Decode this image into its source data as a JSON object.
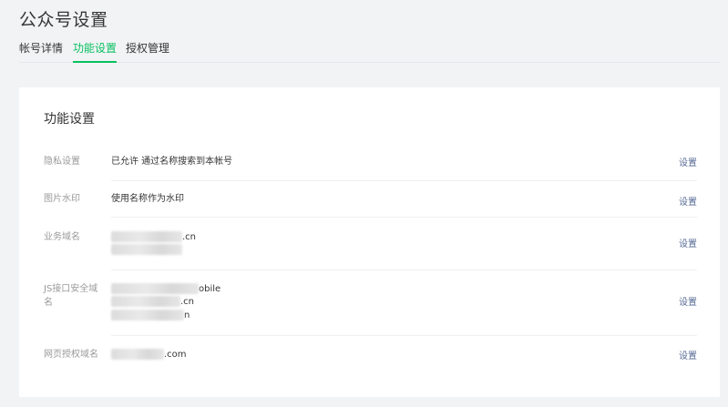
{
  "page_title": "公众号设置",
  "tabs": [
    {
      "label": "帐号详情"
    },
    {
      "label": "功能设置"
    },
    {
      "label": "授权管理"
    }
  ],
  "card": {
    "title": "功能设置",
    "rows": [
      {
        "label": "隐私设置",
        "value": "已允许 通过名称搜索到本帐号",
        "action": "设置"
      },
      {
        "label": "图片水印",
        "value": "使用名称作为水印",
        "action": "设置"
      },
      {
        "label": "业务域名",
        "values": [
          ".cn"
        ],
        "action": "设置"
      },
      {
        "label_line1": "JS接口安全域",
        "label_line2": "名",
        "values": [
          "obile",
          ".cn",
          "n"
        ],
        "action": "设置"
      },
      {
        "label": "网页授权域名",
        "values": ".com",
        "action": "设置"
      }
    ]
  }
}
